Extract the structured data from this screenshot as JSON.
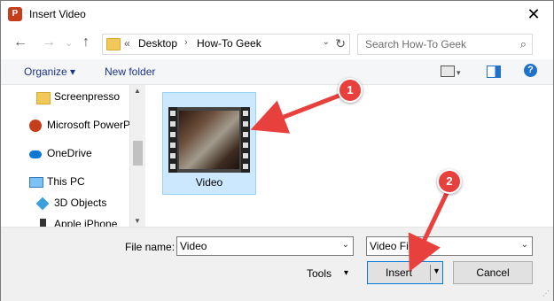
{
  "window": {
    "title": "Insert Video",
    "close_glyph": "✕",
    "app_icon_letter": "P"
  },
  "nav": {
    "back": "←",
    "forward": "→",
    "up": "↑",
    "address": {
      "chev": "«",
      "crumbs": [
        "Desktop",
        "How-To Geek"
      ],
      "sep": "›",
      "dropdown": "⌄",
      "refresh": "↻"
    },
    "search": {
      "placeholder": "Search How-To Geek",
      "icon": "⌕"
    }
  },
  "toolbar": {
    "organize": "Organize ▾",
    "new_folder": "New folder",
    "help": "?"
  },
  "sidebar": {
    "items": [
      {
        "label": "Screenpresso",
        "icon": "folder-icon"
      },
      {
        "label": "Microsoft PowerP",
        "icon": "powerpoint-icon"
      },
      {
        "label": "OneDrive",
        "icon": "cloud-icon"
      },
      {
        "label": "This PC",
        "icon": "computer-icon"
      },
      {
        "label": "3D Objects",
        "icon": "cube-icon"
      },
      {
        "label": "Apple iPhone",
        "icon": "phone-icon"
      }
    ]
  },
  "files": [
    {
      "name": "Video",
      "type": "video"
    }
  ],
  "callouts": [
    "1",
    "2"
  ],
  "bottom": {
    "file_name_label": "File name:",
    "file_name_value": "Video",
    "file_type_value": "Video Fil",
    "tools_label": "Tools",
    "insert_label": "Insert",
    "cancel_label": "Cancel"
  },
  "colors": {
    "accent": "#0078d7",
    "callout": "#e8413d",
    "selection": "#cce8ff"
  }
}
